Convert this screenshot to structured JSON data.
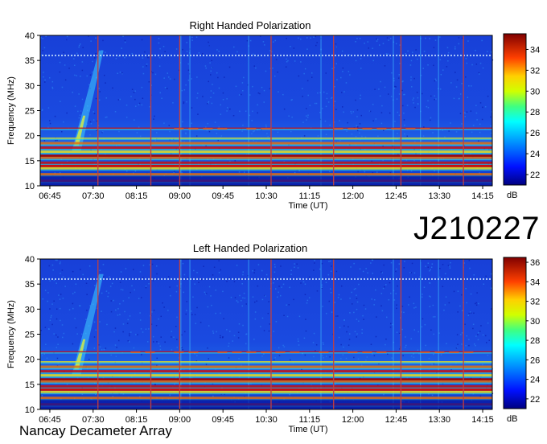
{
  "observation_code": "J210227",
  "footer_label": "Nancay Decameter Array",
  "colors": {
    "background": "#1a3fd8",
    "noise_bright": "#38c8ff",
    "band_red": "#c81010",
    "band_yellow": "#e8e020",
    "cursor_line": "#c04040"
  },
  "chart_data": [
    {
      "type": "heatmap",
      "title": "Right Handed Polarization",
      "xlabel": "Time (UT)",
      "ylabel": "Frequency (MHz)",
      "x_ticks": [
        "06:45",
        "07:30",
        "08:15",
        "09:00",
        "09:45",
        "10:30",
        "11:15",
        "12:00",
        "12:45",
        "13:30",
        "14:15"
      ],
      "y_ticks": [
        10,
        15,
        20,
        25,
        30,
        35,
        40
      ],
      "ylim": [
        10,
        40
      ],
      "colorbar": {
        "ticks": [
          22,
          24,
          26,
          28,
          30,
          32,
          34
        ],
        "unit": "dB",
        "range": [
          21,
          35.5
        ]
      },
      "vertical_markers_utc": [
        "07:35",
        "08:30",
        "09:00",
        "10:35",
        "11:40",
        "12:50",
        "13:55"
      ],
      "horizontal_bands_mhz": [
        11,
        12.3,
        13.5,
        14.6,
        15.6,
        16.8,
        17.6,
        18.5,
        19.5,
        21.5,
        36
      ]
    },
    {
      "type": "heatmap",
      "title": "Left Handed Polarization",
      "xlabel": "Time (UT)",
      "ylabel": "Frequency (MHz)",
      "x_ticks": [
        "06:45",
        "07:30",
        "08:15",
        "09:00",
        "09:45",
        "10:30",
        "11:15",
        "12:00",
        "12:45",
        "13:30",
        "14:15"
      ],
      "y_ticks": [
        10,
        15,
        20,
        25,
        30,
        35,
        40
      ],
      "ylim": [
        10,
        40
      ],
      "colorbar": {
        "ticks": [
          22,
          24,
          26,
          28,
          30,
          32,
          34,
          36
        ],
        "unit": "dB",
        "range": [
          21,
          36.5
        ]
      },
      "vertical_markers_utc": [
        "07:35",
        "08:30",
        "09:00",
        "10:35",
        "11:40",
        "12:50",
        "13:55"
      ],
      "horizontal_bands_mhz": [
        11,
        12.3,
        13.5,
        14.6,
        15.6,
        16.8,
        17.6,
        18.5,
        19.5,
        21.5,
        36
      ]
    }
  ]
}
